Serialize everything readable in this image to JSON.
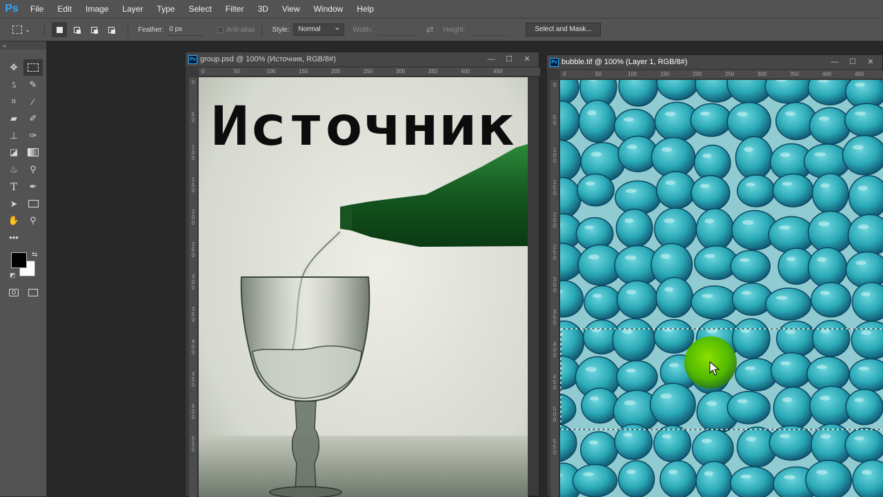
{
  "app": {
    "logo": "Ps"
  },
  "menu": [
    "File",
    "Edit",
    "Image",
    "Layer",
    "Type",
    "Select",
    "Filter",
    "3D",
    "View",
    "Window",
    "Help"
  ],
  "options": {
    "feather_label": "Feather:",
    "feather_value": "0 px",
    "antialias_label": "Anti-alias",
    "style_label": "Style:",
    "style_value": "Normal",
    "width_label": "Width:",
    "height_label": "Height:",
    "select_mask_label": "Select and Mask..."
  },
  "toolbar": {
    "collapse_label": "«",
    "tools": [
      [
        "move-tool",
        "rect-marquee-tool"
      ],
      [
        "lasso-tool",
        "quick-selection-tool"
      ],
      [
        "crop-tool",
        "eyedropper-tool"
      ],
      [
        "healing-brush-tool",
        "brush-tool"
      ],
      [
        "clone-stamp-tool",
        "history-brush-tool"
      ],
      [
        "eraser-tool",
        "gradient-tool"
      ],
      [
        "blur-tool",
        "dodge-tool"
      ],
      [
        "type-tool",
        "pen-tool"
      ],
      [
        "path-selection-tool",
        "rectangle-tool"
      ],
      [
        "hand-tool",
        "zoom-tool"
      ],
      [
        "more-tools",
        ""
      ]
    ],
    "foreground_color": "#000000",
    "background_color": "#ffffff"
  },
  "doc1": {
    "title": "group.psd @ 100% (Источник, RGB/8#)",
    "text_layer": "Источник",
    "hruler": [
      "0",
      "50",
      "100",
      "150",
      "200",
      "250",
      "300",
      "350",
      "400",
      "450"
    ],
    "vruler": [
      "0",
      "5 0",
      "1 0 0",
      "1 5 0",
      "2 0 0",
      "2 5 0",
      "3 0 0",
      "3 5 0",
      "4 0 0",
      "4 5 0",
      "5 0 0",
      "5 5 0"
    ]
  },
  "doc2": {
    "title": "bubble.tif @ 100% (Layer 1, RGB/8#)",
    "hruler": [
      "0",
      "50",
      "100",
      "150",
      "200",
      "250",
      "300",
      "350",
      "400",
      "450"
    ],
    "vruler": [
      "0",
      "5 0",
      "1 0 0",
      "1 5 0",
      "2 0 0",
      "2 5 0",
      "3 0 0",
      "3 5 0",
      "4 0 0",
      "4 5 0",
      "5 0 0",
      "5 5 0"
    ]
  },
  "colors": {
    "accent": "#31a8ff",
    "bubble": "#2fb8c2",
    "bubble_dark": "#0e5a7a",
    "bottle": "#1f6a2a",
    "highlight": "#5ec800"
  }
}
